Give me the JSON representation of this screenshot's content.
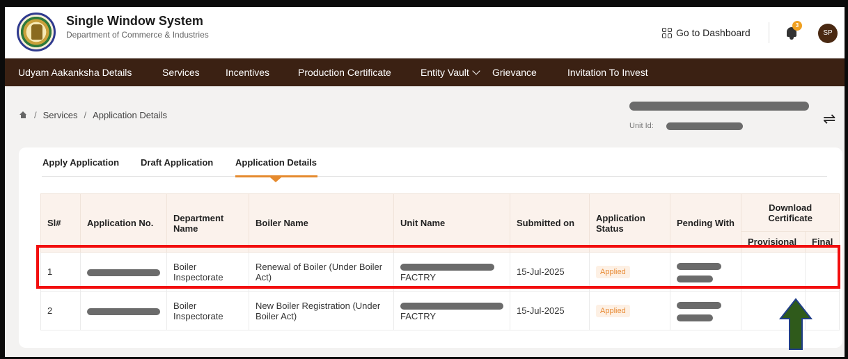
{
  "header": {
    "title": "Single Window System",
    "subtitle": "Department of Commerce & Industries",
    "dashboard_link": "Go to Dashboard",
    "notification_count": "3",
    "avatar_initials": "SP"
  },
  "nav": {
    "items": [
      "Udyam Aakanksha Details",
      "Services",
      "Incentives",
      "Production Certificate",
      "Entity Vault",
      "Grievance",
      "Invitation To Invest"
    ]
  },
  "breadcrumb": {
    "items": [
      "Services",
      "Application Details"
    ],
    "separator": "/"
  },
  "unit": {
    "id_label": "Unit Id:"
  },
  "tabs": [
    "Apply Application",
    "Draft Application",
    "Application Details"
  ],
  "table": {
    "headers": {
      "sl": "Sl#",
      "app_no": "Application No.",
      "department": "Department Name",
      "boiler": "Boiler Name",
      "unit": "Unit Name",
      "submitted": "Submitted on",
      "status": "Application Status",
      "pending": "Pending With",
      "download": "Download Certificate",
      "provisional": "Provisional",
      "final": "Final"
    },
    "rows": [
      {
        "sl": "1",
        "department": "Boiler Inspectorate",
        "boiler": "Renewal of Boiler (Under Boiler Act)",
        "unit_tail": "FACTRY",
        "submitted": "15-Jul-2025",
        "status": "Applied"
      },
      {
        "sl": "2",
        "department": "Boiler Inspectorate",
        "boiler": "New Boiler Registration (Under Boiler Act)",
        "unit_tail": "FACTRY",
        "submitted": "15-Jul-2025",
        "status": "Applied"
      }
    ]
  },
  "colors": {
    "nav_bg": "#3b2113",
    "accent": "#e58a2e",
    "highlight": "#f20e0e",
    "arrow": "#2f5a1b"
  }
}
